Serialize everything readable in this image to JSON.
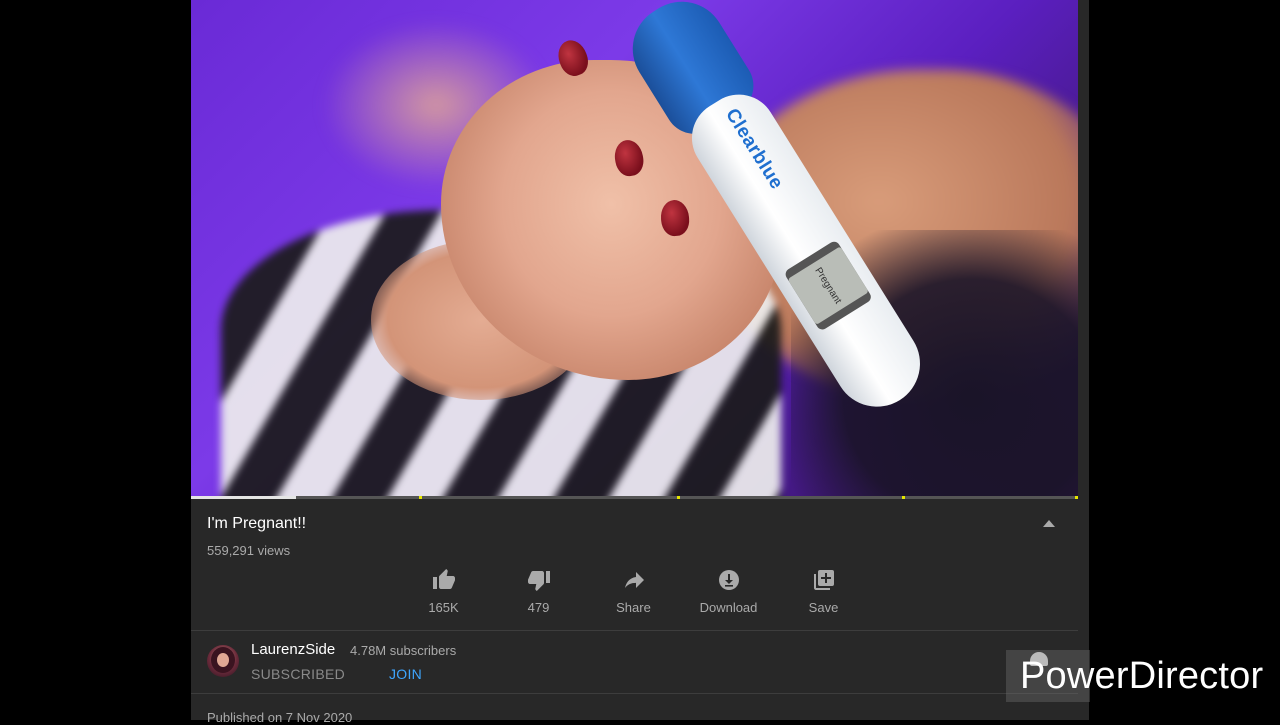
{
  "video": {
    "brand_text": "Clearblue",
    "display_text": "Pregnant",
    "progress_fraction": 0.118
  },
  "details": {
    "title": "I'm Pregnant!!",
    "views": "559,291 views",
    "published": "Published on 7 Nov 2020"
  },
  "actions": [
    {
      "label": "165K",
      "icon": "thumbs-up-icon"
    },
    {
      "label": "479",
      "icon": "thumbs-down-icon"
    },
    {
      "label": "Share",
      "icon": "share-icon"
    },
    {
      "label": "Download",
      "icon": "download-icon"
    },
    {
      "label": "Save",
      "icon": "save-playlist-icon"
    }
  ],
  "channel": {
    "name": "LaurenzSide",
    "subscribers": "4.78M subscribers",
    "subscribed_label": "SUBSCRIBED",
    "join_label": "JOIN"
  },
  "watermark": "PowerDirector",
  "colors": {
    "panel": "#282828",
    "join": "#3ea6ff",
    "ad_marker": "#e6e600"
  }
}
